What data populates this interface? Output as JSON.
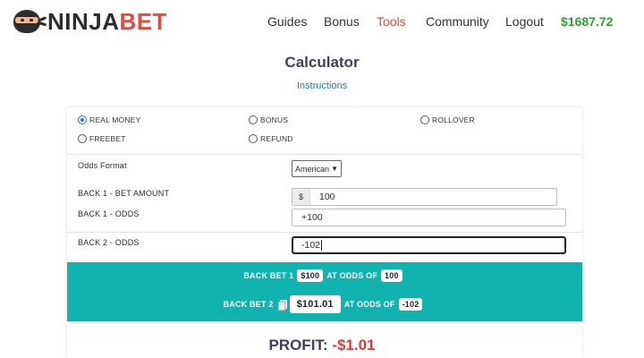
{
  "brand": {
    "name_part1": "NINJA",
    "name_part2": "BET"
  },
  "nav": {
    "items": [
      "Guides",
      "Bonus",
      "Tools",
      "Community",
      "Logout"
    ],
    "active": "Tools",
    "balance": "$1687.72"
  },
  "page": {
    "title": "Calculator",
    "instructions_link": "Instructions"
  },
  "bet_types": {
    "options": [
      "REAL MONEY",
      "BONUS",
      "ROLLOVER",
      "FREEBET",
      "REFUND"
    ],
    "selected": "REAL MONEY"
  },
  "odds_format": {
    "label": "Odds Format",
    "value": "American"
  },
  "back1": {
    "amount_label": "BACK 1 - BET AMOUNT",
    "currency": "$",
    "amount": "100",
    "odds_label": "BACK 1 - ODDS",
    "odds": "+100"
  },
  "back2": {
    "odds_label": "BACK 2 - ODDS",
    "odds": "-102"
  },
  "result": {
    "bet1_label": "BACK BET 1",
    "bet1_amount": "$100",
    "at_odds_label": "AT ODDS OF",
    "bet1_odds": "100",
    "bet2_label": "BACK BET 2",
    "bet2_amount": "$101.01",
    "bet2_odds": "-102",
    "profit_label": "PROFIT:",
    "profit_value": "-$1.01"
  },
  "colors": {
    "accent": "#e5483d",
    "teal": "#11b3b0",
    "balance": "#2e9e2e",
    "loss": "#e53935"
  }
}
